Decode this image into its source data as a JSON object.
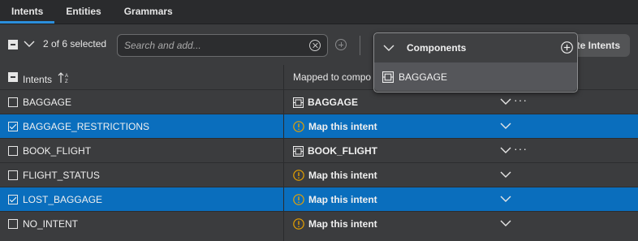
{
  "tabs": [
    {
      "label": "Intents",
      "active": true
    },
    {
      "label": "Entities",
      "active": false
    },
    {
      "label": "Grammars",
      "active": false
    }
  ],
  "toolbar": {
    "selection_text": "2 of 6 selected",
    "search_placeholder": "Search and add...",
    "search_value": "",
    "update_button_label": "te Intents"
  },
  "table": {
    "headers": {
      "intents": "Intents",
      "mapped": "Mapped to compo"
    },
    "rows": [
      {
        "name": "BAGGAGE",
        "selected": false,
        "mapped": "BAGGAGE",
        "mapped_type": "component",
        "has_more": true
      },
      {
        "name": "BAGGAGE_RESTRICTIONS",
        "selected": true,
        "mapped": "Map this intent",
        "mapped_type": "unmapped",
        "has_more": false
      },
      {
        "name": "BOOK_FLIGHT",
        "selected": false,
        "mapped": "BOOK_FLIGHT",
        "mapped_type": "component",
        "has_more": true
      },
      {
        "name": "FLIGHT_STATUS",
        "selected": false,
        "mapped": "Map this intent",
        "mapped_type": "unmapped",
        "has_more": false
      },
      {
        "name": "LOST_BAGGAGE",
        "selected": true,
        "mapped": "Map this intent",
        "mapped_type": "unmapped",
        "has_more": false
      },
      {
        "name": "NO_INTENT",
        "selected": false,
        "mapped": "Map this intent",
        "mapped_type": "unmapped",
        "has_more": false
      }
    ]
  },
  "dropdown": {
    "title": "Components",
    "items": [
      {
        "label": "BAGGAGE"
      }
    ]
  },
  "colors": {
    "selected_row": "#0a6ebd",
    "tab_underline": "#2b8fdc",
    "warning": "#e8a200"
  },
  "icons": {
    "component": "component-icon",
    "warning": "warning-icon",
    "more": "more-icon",
    "sort": "sort-az-icon"
  }
}
